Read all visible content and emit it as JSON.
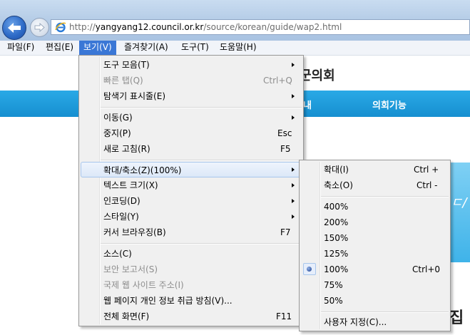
{
  "address_bar": {
    "url_prefix": "http://",
    "url_host": "yangyang12.council.or.kr",
    "url_path": "/source/korean/guide/wap2.html"
  },
  "menubar": {
    "items": [
      {
        "label": "파일(F)"
      },
      {
        "label": "편집(E)"
      },
      {
        "label": "보기(V)"
      },
      {
        "label": "즐겨찾기(A)"
      },
      {
        "label": "도구(T)"
      },
      {
        "label": "도움말(H)"
      }
    ],
    "active_index": 2
  },
  "page": {
    "title_partial": "군의회",
    "nav_partial": "내",
    "nav_item": "의회기능",
    "heading_partial": "집"
  },
  "view_menu": {
    "items": [
      {
        "label": "도구 모음(T)",
        "shortcut": "",
        "submenu": true
      },
      {
        "label": "빠른 탭(Q)",
        "shortcut": "Ctrl+Q",
        "disabled": true
      },
      {
        "label": "탐색기 표시줄(E)",
        "shortcut": "",
        "submenu": true
      },
      {
        "label": "이동(G)",
        "shortcut": "",
        "submenu": true
      },
      {
        "label": "중지(P)",
        "shortcut": "Esc"
      },
      {
        "label": "새로 고침(R)",
        "shortcut": "F5"
      },
      {
        "label": "확대/축소(Z)(100%)",
        "shortcut": "",
        "submenu": true,
        "highlighted": true
      },
      {
        "label": "텍스트 크기(X)",
        "shortcut": "",
        "submenu": true
      },
      {
        "label": "인코딩(D)",
        "shortcut": "",
        "submenu": true
      },
      {
        "label": "스타일(Y)",
        "shortcut": "",
        "submenu": true
      },
      {
        "label": "커서 브라우징(B)",
        "shortcut": "F7"
      },
      {
        "label": "소스(C)",
        "shortcut": ""
      },
      {
        "label": "보안 보고서(S)",
        "shortcut": "",
        "disabled": true
      },
      {
        "label": "국제 웹 사이트 주소(I)",
        "shortcut": "",
        "disabled": true
      },
      {
        "label": "웹 페이지 개인 정보 취급 방침(V)...",
        "shortcut": ""
      },
      {
        "label": "전체 화면(F)",
        "shortcut": "F11"
      }
    ]
  },
  "zoom_menu": {
    "items": [
      {
        "label": "확대(I)",
        "shortcut": "Ctrl +"
      },
      {
        "label": "축소(O)",
        "shortcut": "Ctrl -"
      },
      {
        "label": "400%",
        "shortcut": ""
      },
      {
        "label": "200%",
        "shortcut": ""
      },
      {
        "label": "150%",
        "shortcut": ""
      },
      {
        "label": "125%",
        "shortcut": ""
      },
      {
        "label": "100%",
        "shortcut": "Ctrl+0",
        "checked": true
      },
      {
        "label": "75%",
        "shortcut": ""
      },
      {
        "label": "50%",
        "shortcut": ""
      },
      {
        "label": "사용자 지정(C)...",
        "shortcut": ""
      }
    ]
  },
  "colors": {
    "menu_highlight": "#3a77d6",
    "site_nav": "#168fd0"
  }
}
